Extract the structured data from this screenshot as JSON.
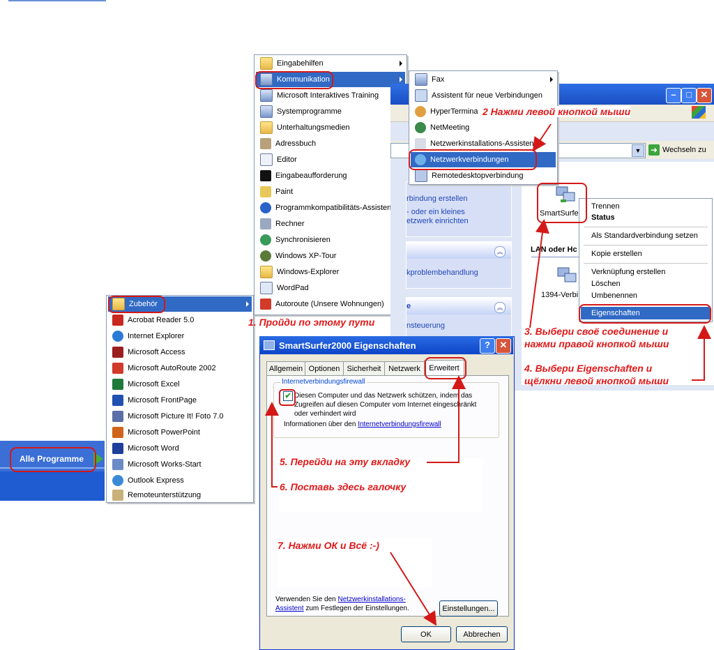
{
  "programs_menu": {
    "items": [
      {
        "label": "Zubehör",
        "icon": "folder-icon",
        "submenu": true,
        "active": true
      },
      {
        "label": "Acrobat Reader 5.0",
        "icon": "acrobat-icon"
      },
      {
        "label": "Internet Explorer",
        "icon": "ie-icon"
      },
      {
        "label": "Microsoft Access",
        "icon": "access-icon"
      },
      {
        "label": "Microsoft AutoRoute 2002",
        "icon": "autoroute-icon"
      },
      {
        "label": "Microsoft Excel",
        "icon": "excel-icon"
      },
      {
        "label": "Microsoft FrontPage",
        "icon": "frontpage-icon"
      },
      {
        "label": "Microsoft Picture It! Foto 7.0",
        "icon": "pictureit-icon"
      },
      {
        "label": "Microsoft PowerPoint",
        "icon": "powerpoint-icon"
      },
      {
        "label": "Microsoft Word",
        "icon": "word-icon"
      },
      {
        "label": "Microsoft Works-Start",
        "icon": "works-icon"
      },
      {
        "label": "Outlook Express",
        "icon": "outlook-icon"
      },
      {
        "label": "Remoteunterstützung",
        "icon": "remote-assist-icon"
      }
    ]
  },
  "start_menu": {
    "all_programs_label": "Alle Programme"
  },
  "accessories_menu": {
    "items": [
      {
        "label": "Eingabehilfen",
        "icon": "folder-icon",
        "submenu": true
      },
      {
        "label": "Kommunikation",
        "icon": "program-group-icon",
        "submenu": true,
        "active": true
      },
      {
        "label": "Microsoft Interaktives Training",
        "icon": "program-group-icon",
        "submenu": true
      },
      {
        "label": "Systemprogramme",
        "icon": "program-group-icon",
        "submenu": true
      },
      {
        "label": "Unterhaltungsmedien",
        "icon": "folder-icon",
        "submenu": true
      },
      {
        "label": "Adressbuch",
        "icon": "addressbook-icon"
      },
      {
        "label": "Editor",
        "icon": "notepad-icon"
      },
      {
        "label": "Eingabeaufforderung",
        "icon": "cmd-icon"
      },
      {
        "label": "Paint",
        "icon": "paint-icon"
      },
      {
        "label": "Programmkompatibilitäts-Assistent",
        "icon": "help-icon"
      },
      {
        "label": "Rechner",
        "icon": "calculator-icon"
      },
      {
        "label": "Synchronisieren",
        "icon": "sync-icon"
      },
      {
        "label": "Windows XP-Tour",
        "icon": "tour-icon"
      },
      {
        "label": "Windows-Explorer",
        "icon": "explorer-icon"
      },
      {
        "label": "WordPad",
        "icon": "wordpad-icon"
      },
      {
        "label": "Autoroute (Unsere Wohnungen)",
        "icon": "autoroute-icon"
      }
    ]
  },
  "communication_menu": {
    "items": [
      {
        "label": "Fax",
        "icon": "program-group-icon",
        "submenu": true
      },
      {
        "label": "Assistent für neue Verbindungen",
        "icon": "wizard-icon"
      },
      {
        "label": "HyperTermina",
        "icon": "hyperterminal-icon"
      },
      {
        "label": "NetMeeting",
        "icon": "netmeeting-icon"
      },
      {
        "label": "Netzwerkinstallations-Assistent",
        "icon": "network-wizard-icon"
      },
      {
        "label": "Netzwerkverbindungen",
        "icon": "network-connections-icon",
        "active": true
      },
      {
        "label": "Remotedesktopverbindung",
        "icon": "remote-desktop-icon"
      }
    ]
  },
  "explorer_window": {
    "go_label": "Wechseln zu",
    "task_links": [
      "rbindung erstellen",
      "- oder ein kleines",
      "etzwerk einrichten"
    ],
    "pane2_link": "kproblembehandlung",
    "pane3_title": "e",
    "pane3_link": "nsteuerung",
    "connection1": "SmartSurfe",
    "section_label": "LAN oder Hc",
    "connection2": "1394-Verbi"
  },
  "context_menu": {
    "items": [
      "Trennen",
      "Status",
      "Als Standardverbindung setzen",
      "Kopie erstellen",
      "Verknüpfung erstellen",
      "Löschen",
      "Umbenennen",
      "Eigenschaften"
    ]
  },
  "dialog": {
    "title": "SmartSurfer2000 Eigenschaften",
    "tabs": [
      "Allgemein",
      "Optionen",
      "Sicherheit",
      "Netzwerk",
      "Erweitert"
    ],
    "group_label": "Internetverbindungsfirewall",
    "checkbox_text": "Diesen Computer und das Netzwerk schützen, indem das Zugreifen auf diesen Computer vom Internet eingeschränkt oder verhindert wird",
    "checkbox_checked": true,
    "info_prefix": "Informationen über den ",
    "info_link": "Internetverbindungsfirewall",
    "bottom_prefix": "Verwenden Sie den ",
    "bottom_link": "Netzwerkinstallations-Assistent",
    "bottom_suffix": " zum Festlegen der Einstellungen.",
    "settings_button": "Einstellungen...",
    "ok_button": "OK",
    "cancel_button": "Abbrechen",
    "help_glyph": "?",
    "close_glyph": "✕"
  },
  "annotations": {
    "step1": "1. Пройди по этому пути",
    "step2": "2 Нажми левой кнопкой мыши",
    "step3a": "3. Выбери своё соединение и",
    "step3b": "нажми правой кнопкой мыши",
    "step4a": "4. Выбери Eigenschaften и",
    "step4b": "щёлкни левой кнопкой мыши",
    "step5": "5. Перейди на эту вкладку",
    "step6": "6. Поставь здесь галочку",
    "step7": "7. Нажми ОК и Всё :-)",
    "color": "#e0191a"
  }
}
